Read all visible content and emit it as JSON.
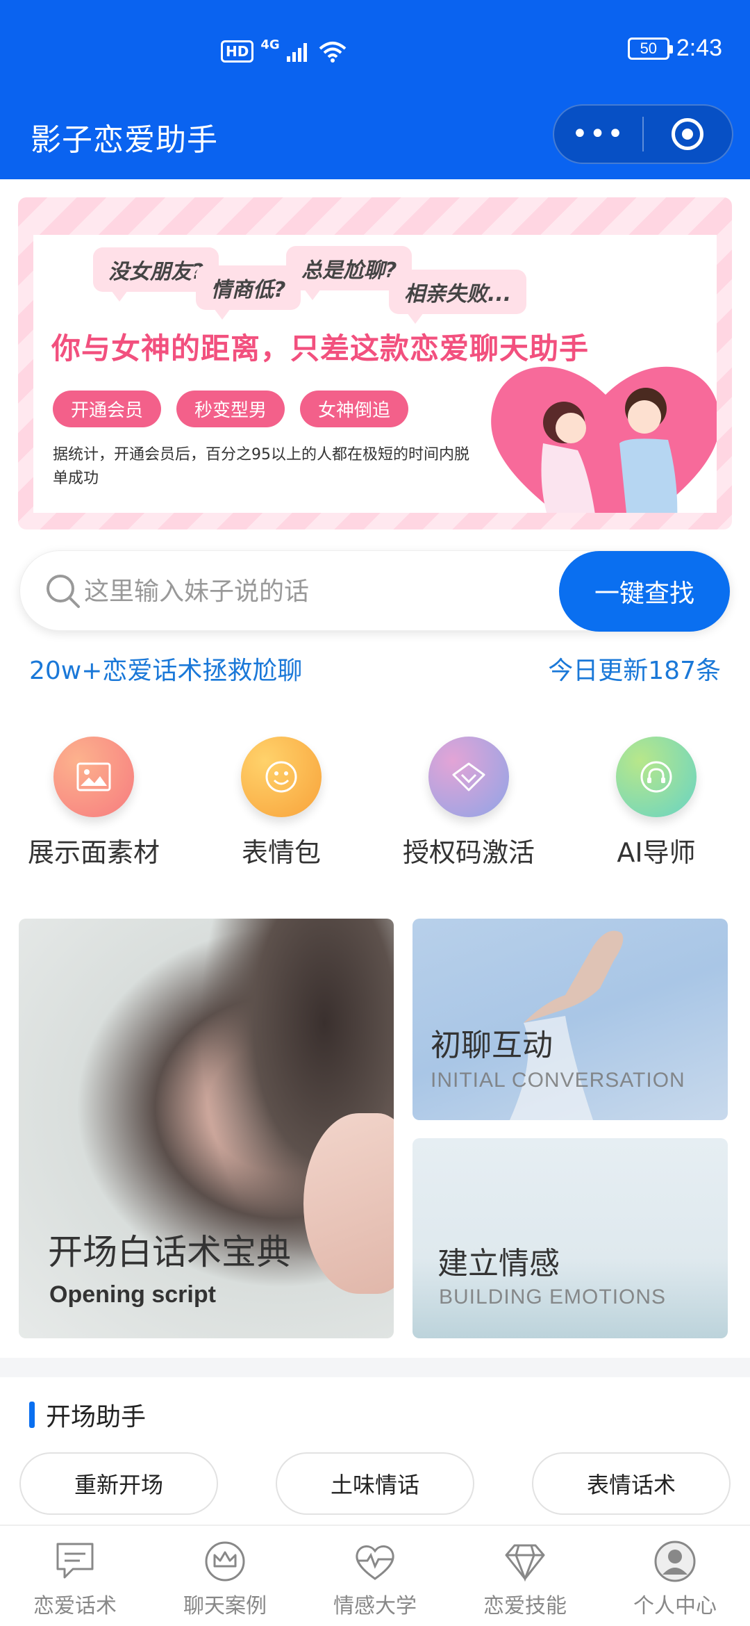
{
  "status_bar": {
    "hd": "HD",
    "network": "4G",
    "battery": "50",
    "time": "2:43"
  },
  "header": {
    "title": "影子恋爱助手"
  },
  "banner": {
    "bubbles": [
      "没女朋友?",
      "情商低?",
      "总是尬聊?",
      "相亲失败..."
    ],
    "headline": "你与女神的距离，只差这款恋爱聊天助手",
    "tags": [
      "开通会员",
      "秒变型男",
      "女神倒追"
    ],
    "note": "据统计，开通会员后，百分之95以上的人都在极短的时间内脱单成功"
  },
  "search": {
    "placeholder": "这里输入妹子说的话",
    "button": "一键查找"
  },
  "info": {
    "left": "20w+恋爱话术拯救尬聊",
    "right": "今日更新187条"
  },
  "quick_actions": [
    {
      "label": "展示面素材",
      "icon": "image-icon",
      "color": "#f78a7a"
    },
    {
      "label": "表情包",
      "icon": "smiley-icon",
      "color": "#fbb44a"
    },
    {
      "label": "授权码激活",
      "icon": "diamond-icon",
      "color": "#b59ee0"
    },
    {
      "label": "AI导师",
      "icon": "headset-icon",
      "color": "#7fd3b8"
    }
  ],
  "cards": {
    "opening": {
      "title": "开场白话术宝典",
      "subtitle": "Opening script"
    },
    "initial": {
      "title": "初聊互动",
      "subtitle": "INITIAL CONVERSATION"
    },
    "emotion": {
      "title": "建立情感",
      "subtitle": "BUILDING EMOTIONS"
    }
  },
  "section": {
    "title": "开场助手",
    "pills": [
      "重新开场",
      "土味情话",
      "表情话术"
    ]
  },
  "tabbar": [
    {
      "label": "恋爱话术",
      "icon": "chat-icon"
    },
    {
      "label": "聊天案例",
      "icon": "crown-icon"
    },
    {
      "label": "情感大学",
      "icon": "heartbeat-icon"
    },
    {
      "label": "恋爱技能",
      "icon": "diamond-icon"
    },
    {
      "label": "个人中心",
      "icon": "user-icon"
    }
  ],
  "colors": {
    "primary": "#0a63f0",
    "button": "#0a6ff0",
    "accent_pink": "#f2507e",
    "info_text": "#1a78d8"
  }
}
